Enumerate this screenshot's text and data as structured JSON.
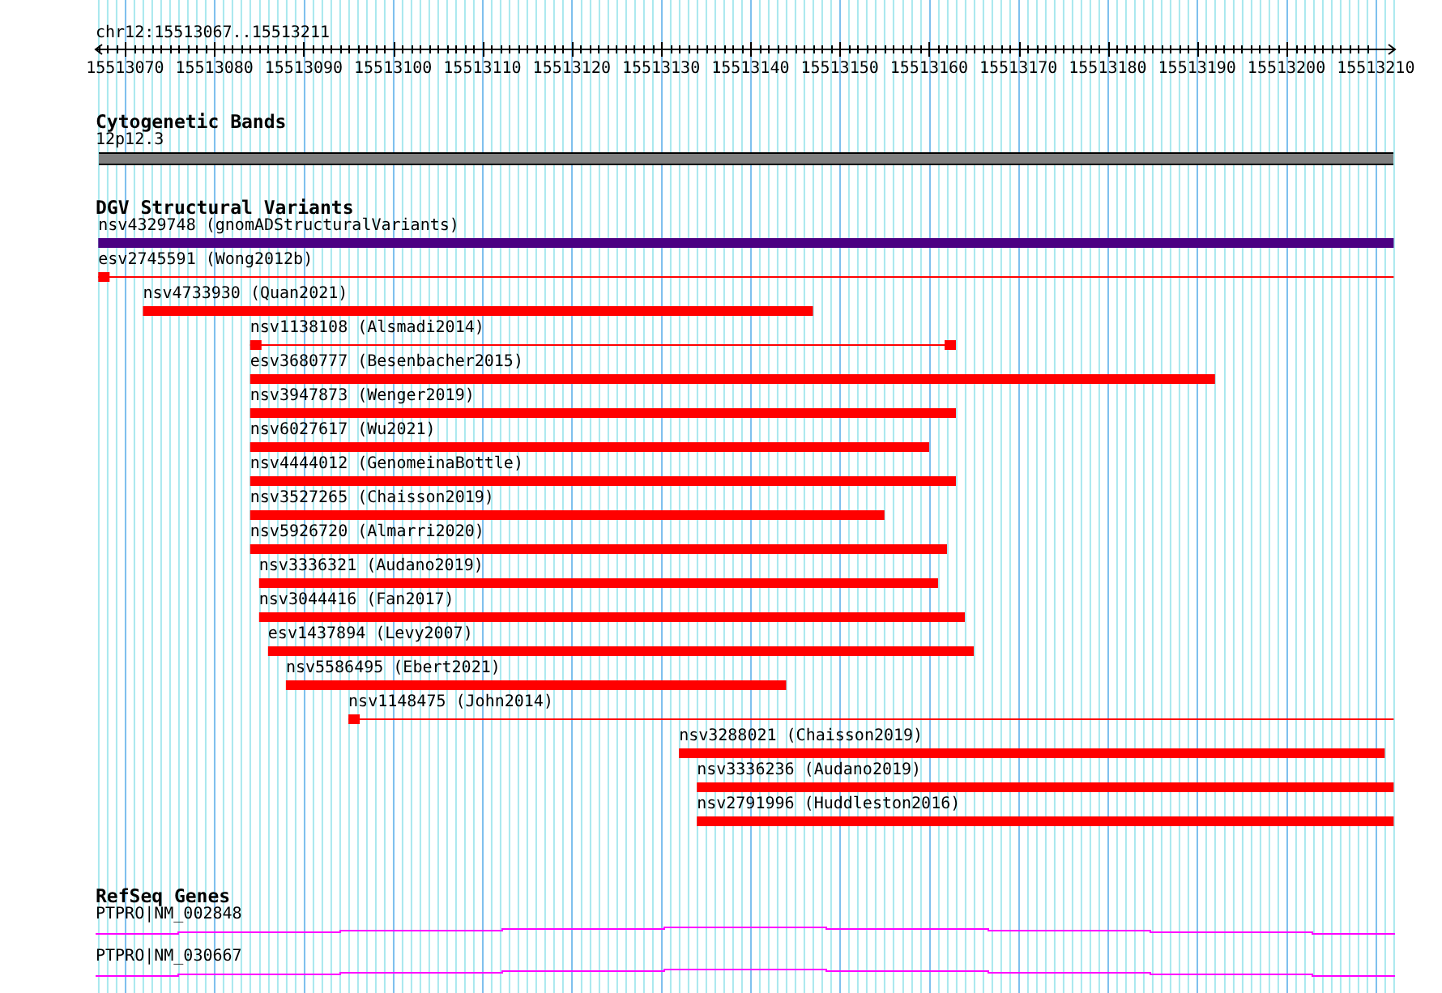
{
  "location": "chr12:15513067..15513211",
  "ruler": {
    "ticks": [
      "15513070",
      "15513080",
      "15513090",
      "15513100",
      "15513110",
      "15513120",
      "15513130",
      "15513140",
      "15513150",
      "15513160",
      "15513170",
      "15513180",
      "15513190",
      "15513200",
      "15513210"
    ]
  },
  "tracks": [
    {
      "kind": "bands",
      "title": "Cytogenetic Bands",
      "features": [
        {
          "label": "12p12.3"
        }
      ]
    },
    {
      "kind": "variants",
      "title": "DGV Structural Variants",
      "features": [
        {
          "label": "nsv4329748 (gnomADStructuralVariants)",
          "color": "#4b0082"
        },
        {
          "label": "esv2745591 (Wong2012b)",
          "color": "#ff0000"
        },
        {
          "label": "nsv4733930 (Quan2021)",
          "color": "#ff0000"
        },
        {
          "label": "nsv1138108 (Alsmadi2014)",
          "color": "#ff0000"
        },
        {
          "label": "esv3680777 (Besenbacher2015)",
          "color": "#ff0000"
        },
        {
          "label": "nsv3947873 (Wenger2019)",
          "color": "#ff0000"
        },
        {
          "label": "nsv6027617 (Wu2021)",
          "color": "#ff0000"
        },
        {
          "label": "nsv4444012 (GenomeinaBottle)",
          "color": "#ff0000"
        },
        {
          "label": "nsv3527265 (Chaisson2019)",
          "color": "#ff0000"
        },
        {
          "label": "nsv5926720 (Almarri2020)",
          "color": "#ff0000"
        },
        {
          "label": "nsv3336321 (Audano2019)",
          "color": "#ff0000"
        },
        {
          "label": "nsv3044416 (Fan2017)",
          "color": "#ff0000"
        },
        {
          "label": "esv1437894 (Levy2007)",
          "color": "#ff0000"
        },
        {
          "label": "nsv5586495 (Ebert2021)",
          "color": "#ff0000"
        },
        {
          "label": "nsv1148475 (John2014)",
          "color": "#ff0000"
        },
        {
          "label": "nsv3288021 (Chaisson2019)",
          "color": "#ff0000"
        },
        {
          "label": "nsv3336236 (Audano2019)",
          "color": "#ff0000"
        },
        {
          "label": "nsv2791996 (Huddleston2016)",
          "color": "#ff0000"
        }
      ]
    },
    {
      "kind": "genes",
      "title": "RefSeq Genes",
      "features": [
        {
          "label": "PTPRO|NM_002848"
        },
        {
          "label": "PTPRO|NM_030667"
        }
      ]
    }
  ]
}
